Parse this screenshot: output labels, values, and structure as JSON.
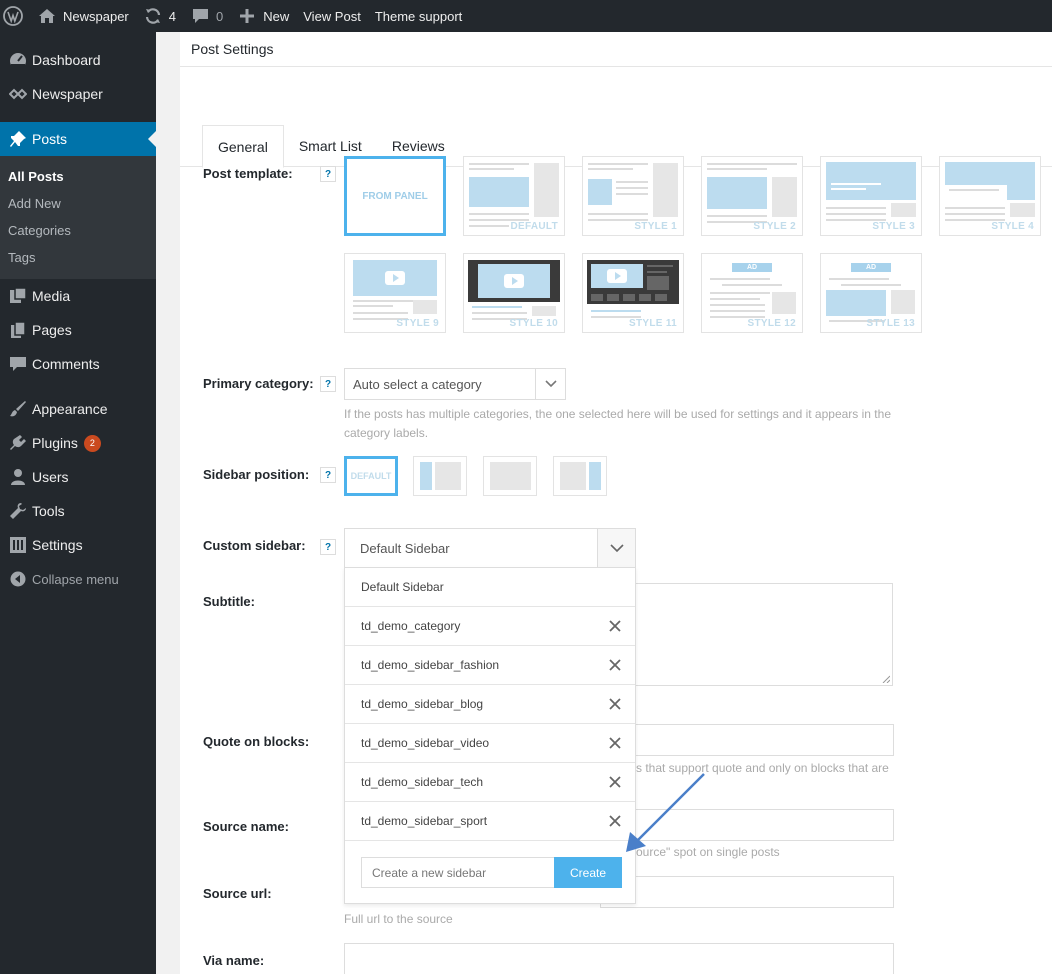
{
  "adminbar": {
    "site_name": "Newspaper",
    "updates_count": "4",
    "comments_count": "0",
    "new_label": "New",
    "view_post_label": "View Post",
    "theme_support_label": "Theme support"
  },
  "sidebar": {
    "items": [
      {
        "label": "Dashboard",
        "icon": "dashboard-icon"
      },
      {
        "label": "Newspaper",
        "icon": "newspaper-icon"
      },
      {
        "label": "Posts",
        "icon": "pin-icon"
      },
      {
        "label": "Media",
        "icon": "media-icon"
      },
      {
        "label": "Pages",
        "icon": "pages-icon"
      },
      {
        "label": "Comments",
        "icon": "comment-icon"
      },
      {
        "label": "Appearance",
        "icon": "paintbrush-icon"
      },
      {
        "label": "Plugins",
        "icon": "plugin-icon",
        "badge": "2"
      },
      {
        "label": "Users",
        "icon": "users-icon"
      },
      {
        "label": "Tools",
        "icon": "wrench-icon"
      },
      {
        "label": "Settings",
        "icon": "settings-icon"
      }
    ],
    "posts_submenu": [
      "All Posts",
      "Add New",
      "Categories",
      "Tags"
    ],
    "collapse_label": "Collapse menu"
  },
  "panel": {
    "title": "Post Settings",
    "tabs": [
      "General",
      "Smart List",
      "Reviews"
    ],
    "active_tab": "General"
  },
  "post_template": {
    "label": "Post template:",
    "help": "?",
    "styles": [
      "FROM PANEL",
      "DEFAULT",
      "STYLE 1",
      "STYLE 2",
      "STYLE 3",
      "STYLE 4",
      "STYLE 9",
      "STYLE 10",
      "STYLE 11",
      "STYLE 12",
      "STYLE 13"
    ],
    "ad_label": "AD"
  },
  "primary_category": {
    "label": "Primary category:",
    "help": "?",
    "value": "Auto select a category",
    "description_line1": "If the posts has multiple categories, the one selected here will be used for settings and it appears in the",
    "description_line2": "category labels."
  },
  "sidebar_position": {
    "label": "Sidebar position:",
    "help": "?",
    "default_label": "DEFAULT"
  },
  "custom_sidebar": {
    "label": "Custom sidebar:",
    "help": "?",
    "value": "Default Sidebar",
    "options": [
      "Default Sidebar",
      "td_demo_category",
      "td_demo_sidebar_fashion",
      "td_demo_sidebar_blog",
      "td_demo_sidebar_video",
      "td_demo_sidebar_tech",
      "td_demo_sidebar_sport"
    ],
    "new_placeholder": "Create a new sidebar",
    "create_label": "Create"
  },
  "fields": {
    "subtitle_label": "Subtitle:",
    "quote_label": "Quote on blocks:",
    "quote_desc_fragment": "s that support quote and only on blocks that are",
    "source_name_label": "Source name:",
    "source_name_desc_fragment": "ource\" spot on single posts",
    "source_url_label": "Source url:",
    "source_url_desc": "Full url to the source",
    "via_name_label": "Via name:"
  },
  "colors": {
    "admin_dark": "#23282d",
    "active_blue": "#0073aa",
    "accent": "#4db2ec",
    "badge": "#ca4a1f",
    "arrow": "#4a7fc9"
  }
}
